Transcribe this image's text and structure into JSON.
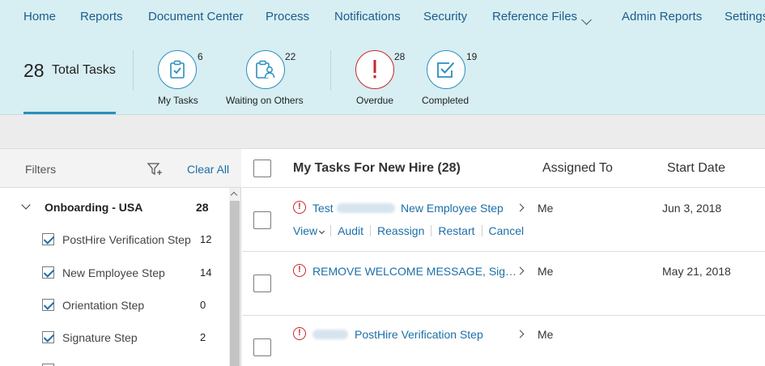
{
  "nav": {
    "items": [
      "Home",
      "Reports",
      "Document Center",
      "Process",
      "Notifications",
      "Security",
      "Reference Files",
      "Admin Reports",
      "Settings"
    ]
  },
  "summary": {
    "total_count": "28",
    "total_label": "Total Tasks",
    "stats": [
      {
        "label": "My Tasks",
        "count": "6",
        "icon": "clipboard-check-icon"
      },
      {
        "label": "Waiting on Others",
        "count": "22",
        "icon": "person-clipboard-icon"
      },
      {
        "label": "Overdue",
        "count": "28",
        "icon": "exclamation-icon"
      },
      {
        "label": "Completed",
        "count": "19",
        "icon": "checkbox-check-icon"
      }
    ]
  },
  "filters": {
    "title": "Filters",
    "clear_all": "Clear All",
    "group": {
      "label": "Onboarding - USA",
      "count": "28"
    },
    "items": [
      {
        "label": "PostHire Verification Step",
        "count": "12",
        "checked": true
      },
      {
        "label": "New Employee Step",
        "count": "14",
        "checked": true
      },
      {
        "label": "Orientation Step",
        "count": "0",
        "checked": true
      },
      {
        "label": "Signature Step",
        "count": "2",
        "checked": true
      }
    ]
  },
  "tasks": {
    "title": "My Tasks For New Hire (28)",
    "columns": {
      "assigned": "Assigned To",
      "start": "Start Date"
    },
    "rows": [
      {
        "prefix": "Test",
        "name": "New Employee Step",
        "assigned": "Me",
        "start": "Jun 3, 2018"
      },
      {
        "prefix": "",
        "name": "REMOVE WELCOME MESSAGE, Sig…",
        "assigned": "Me",
        "start": "May 21, 2018"
      },
      {
        "prefix": "",
        "name": "PostHire Verification Step",
        "assigned": "Me",
        "start": ""
      }
    ],
    "actions": [
      "View",
      "Audit",
      "Reassign",
      "Restart",
      "Cancel"
    ]
  },
  "colors": {
    "accent": "#1b6fa8",
    "overdue": "#c8262b",
    "header_bg": "#d7eef2"
  }
}
